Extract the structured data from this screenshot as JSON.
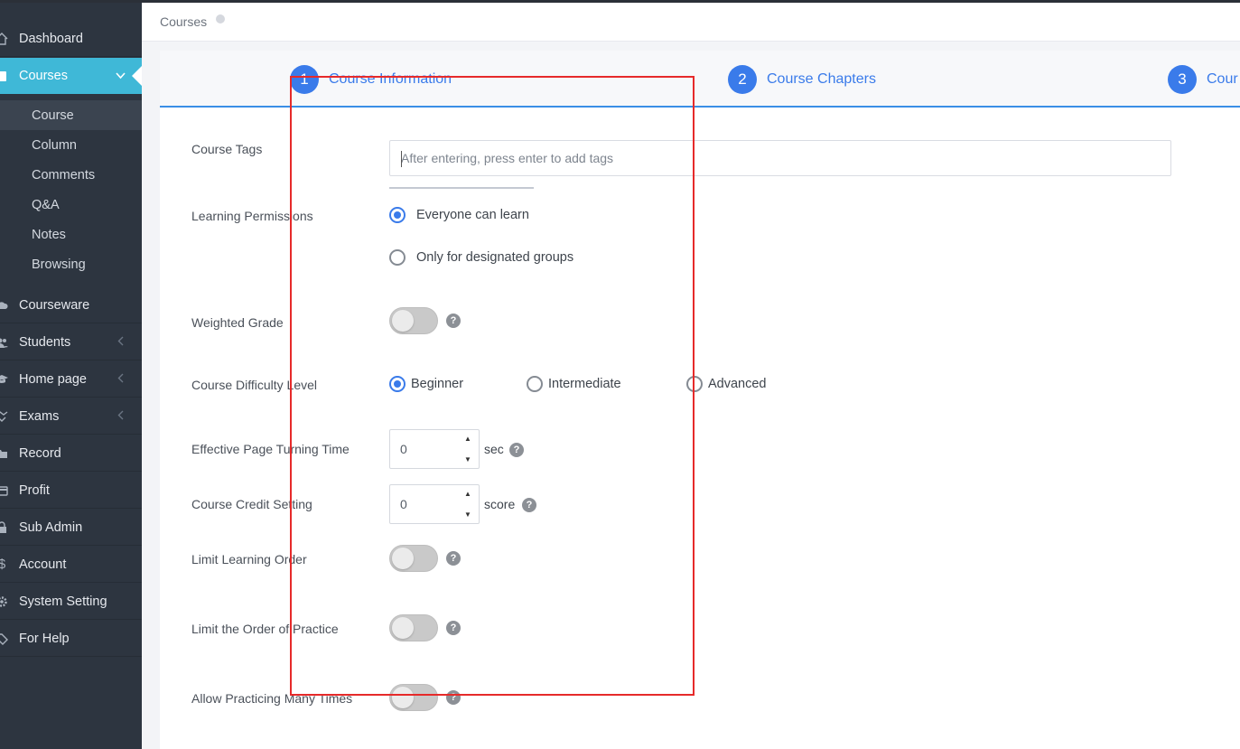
{
  "sidebar": {
    "items": [
      {
        "label": "Dashboard",
        "icon": "home-icon"
      },
      {
        "label": "Courses",
        "icon": "book-icon",
        "active": true
      },
      {
        "label": "Courseware",
        "icon": "cloud-icon"
      },
      {
        "label": "Students",
        "icon": "users-icon"
      },
      {
        "label": "Home page",
        "icon": "graduation-cap-icon"
      },
      {
        "label": "Exams",
        "icon": "handshake-icon"
      },
      {
        "label": "Record",
        "icon": "folder-icon"
      },
      {
        "label": "Profit",
        "icon": "credit-card-icon"
      },
      {
        "label": "Sub Admin",
        "icon": "lock-icon"
      },
      {
        "label": "Account",
        "icon": "dollar-icon"
      },
      {
        "label": "System Setting",
        "icon": "gear-icon"
      },
      {
        "label": "For Help",
        "icon": "tag-icon"
      }
    ],
    "sub_items": [
      "Course",
      "Column",
      "Comments",
      "Q&A",
      "Notes",
      "Browsing"
    ]
  },
  "header": {
    "breadcrumb": "Courses"
  },
  "steps": [
    {
      "num": "1",
      "label": "Course Information"
    },
    {
      "num": "2",
      "label": "Course Chapters"
    },
    {
      "num": "3",
      "label": "Cour"
    }
  ],
  "form": {
    "tags_label": "Course Tags",
    "tags_placeholder": "After entering, press enter to add tags",
    "permissions_label": "Learning Permissions",
    "permission_options": [
      "Everyone can learn",
      "Only for designated groups"
    ],
    "permission_selected": "Everyone can learn",
    "weighted_label": "Weighted Grade",
    "difficulty_label": "Course Difficulty Level",
    "difficulty_options": [
      "Beginner",
      "Intermediate",
      "Advanced"
    ],
    "difficulty_selected": "Beginner",
    "turning_label": "Effective Page Turning Time",
    "turning_value": "0",
    "turning_unit": "sec",
    "credit_label": "Course Credit Setting",
    "credit_value": "0",
    "credit_unit": "score",
    "order_label": "Limit Learning Order",
    "practice_order_label": "Limit the Order of Practice",
    "practice_many_label": "Allow Practicing Many Times",
    "help_glyph": "?"
  }
}
